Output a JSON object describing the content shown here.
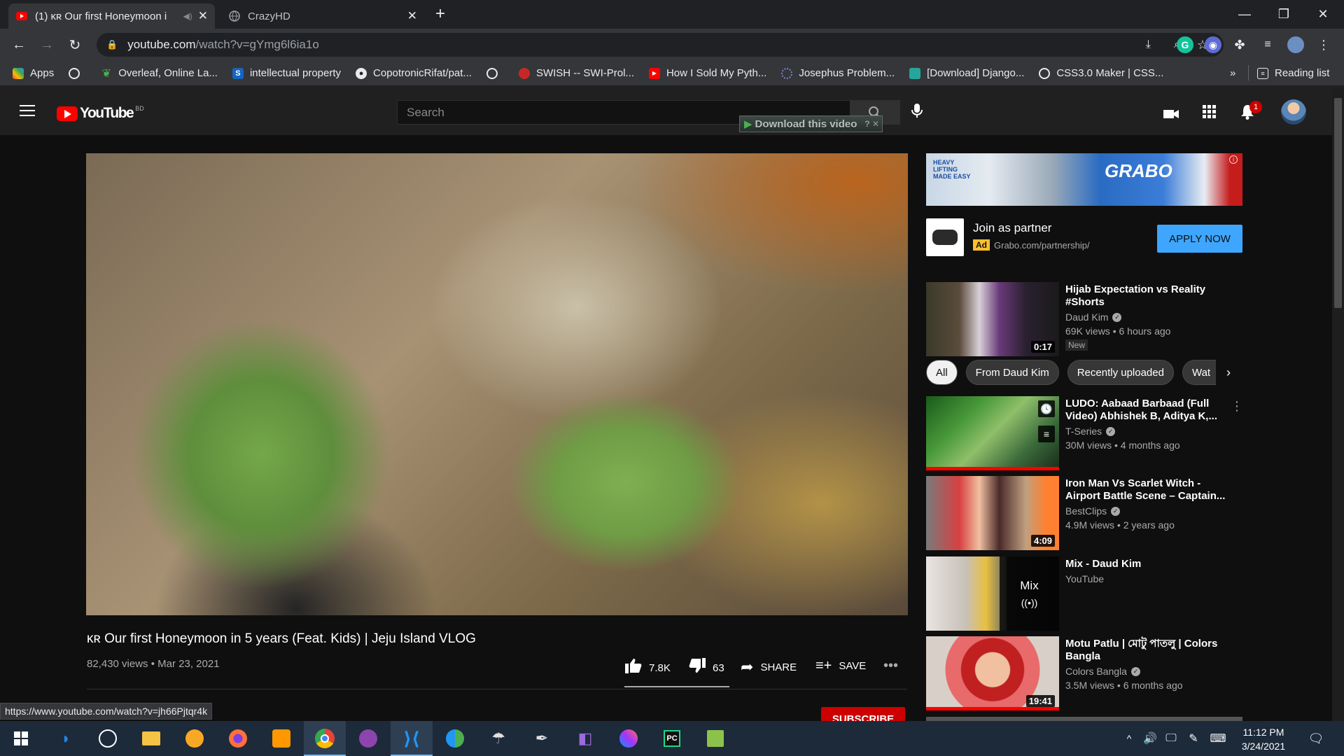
{
  "browser": {
    "tabs": [
      {
        "title": "(1) ᴋʀ Our first Honeymoon i",
        "active": true
      },
      {
        "title": "CrazyHD",
        "active": false
      }
    ],
    "url_host": "youtube.com",
    "url_path": "/watch?v=gYmg6l6ia1o",
    "bookmarks": [
      {
        "label": "Apps",
        "icon": "apps-grid-icon"
      },
      {
        "label": "",
        "icon": "globe-icon"
      },
      {
        "label": "Overleaf, Online La...",
        "icon": "overleaf-icon"
      },
      {
        "label": "intellectual property",
        "icon": "s-icon"
      },
      {
        "label": "CopotronicRifat/pat...",
        "icon": "github-icon"
      },
      {
        "label": "",
        "icon": "globe-icon"
      },
      {
        "label": "SWISH -- SWI-Prol...",
        "icon": "swish-icon"
      },
      {
        "label": "How I Sold My Pyth...",
        "icon": "youtube-icon"
      },
      {
        "label": "Josephus Problem...",
        "icon": "loading-icon"
      },
      {
        "label": "[Download] Django...",
        "icon": "django-icon"
      },
      {
        "label": "CSS3.0 Maker | CSS...",
        "icon": "globe-icon"
      }
    ],
    "bookmarks_more": "»",
    "reading_list": "Reading list",
    "status_url": "https://www.youtube.com/watch?v=jh66Pjtqr4k"
  },
  "youtube": {
    "logo_text": "YouTube",
    "region": "BD",
    "search_placeholder": "Search",
    "download_bar": "Download this video",
    "notification_count": "1",
    "video": {
      "title": "ᴋʀ Our first Honeymoon in 5 years (Feat. Kids) | Jeju Island VLOG",
      "meta": "82,430 views • Mar 23, 2021",
      "likes": "7.8K",
      "dislikes": "63",
      "share": "SHARE",
      "save": "SAVE",
      "subscribe": "SUBSCRIBE"
    },
    "ad": {
      "brand": "GRABO",
      "tagline": "HEAVY LIFTING MADE EASY",
      "title": "Join as partner",
      "badge": "Ad",
      "url": "Grabo.com/partnership/",
      "cta": "APPLY NOW"
    },
    "chips": [
      "All",
      "From Daud Kim",
      "Recently uploaded",
      "Wat"
    ],
    "recommendations": [
      {
        "title": "Hijab Expectation vs Reality #Shorts",
        "channel": "Daud Kim",
        "verified": true,
        "views": "69K views • 6 hours ago",
        "duration": "0:17",
        "badge": "New"
      },
      {
        "title": "LUDO: Aabaad Barbaad (Full Video) Abhishek B, Aditya K,...",
        "channel": "T-Series",
        "verified": true,
        "views": "30M views • 4 months ago",
        "duration": ""
      },
      {
        "title": "Iron Man Vs Scarlet Witch - Airport Battle Scene – Captain...",
        "channel": "BestClips",
        "verified": true,
        "views": "4.9M views • 2 years ago",
        "duration": "4:09"
      },
      {
        "title": "Mix - Daud Kim",
        "channel": "YouTube",
        "verified": false,
        "views": "",
        "duration": "",
        "mix_label": "Mix"
      },
      {
        "title": "Motu Patlu | মোটু পাতলু | Colors Bangla",
        "channel": "Colors Bangla",
        "verified": true,
        "views": "3.5M views • 6 months ago",
        "duration": "19:41"
      }
    ]
  },
  "taskbar": {
    "time": "11:12 PM",
    "date": "3/24/2021"
  }
}
